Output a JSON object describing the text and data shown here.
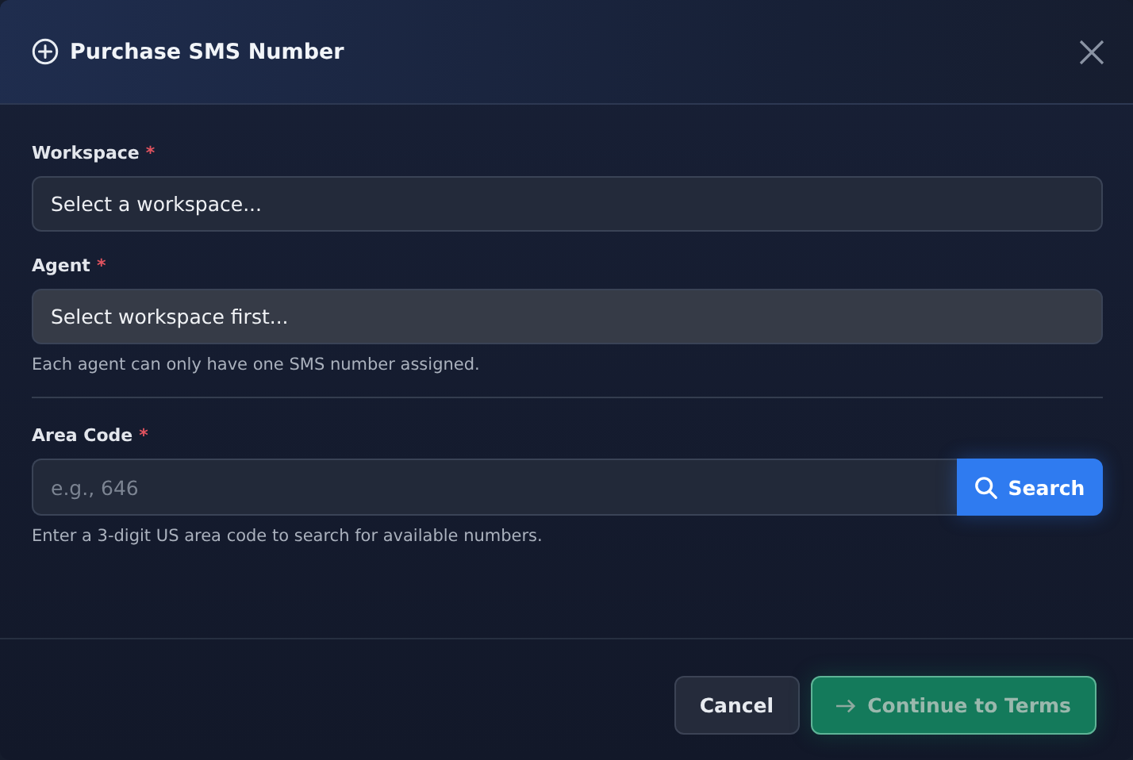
{
  "dialog": {
    "title": "Purchase SMS Number",
    "fields": [
      {
        "kind": "select",
        "label": "Workspace",
        "required_mark": "*",
        "value": "Select a workspace...",
        "disabled": false
      },
      {
        "kind": "select",
        "label": "Agent",
        "required_mark": "*",
        "value": "Select workspace first...",
        "disabled": true,
        "help": "Each agent can only have one SMS number assigned."
      },
      {
        "kind": "search",
        "label": "Area Code",
        "required_mark": "*",
        "placeholder": "e.g., 646",
        "button": "Search",
        "help": "Enter a 3-digit US area code to search for available numbers.",
        "divider_before": true
      }
    ],
    "buttons": [
      {
        "label": "Cancel",
        "kind": "secondary",
        "disabled": false
      },
      {
        "label": "Continue to Terms",
        "kind": "primary",
        "disabled": true
      }
    ]
  }
}
